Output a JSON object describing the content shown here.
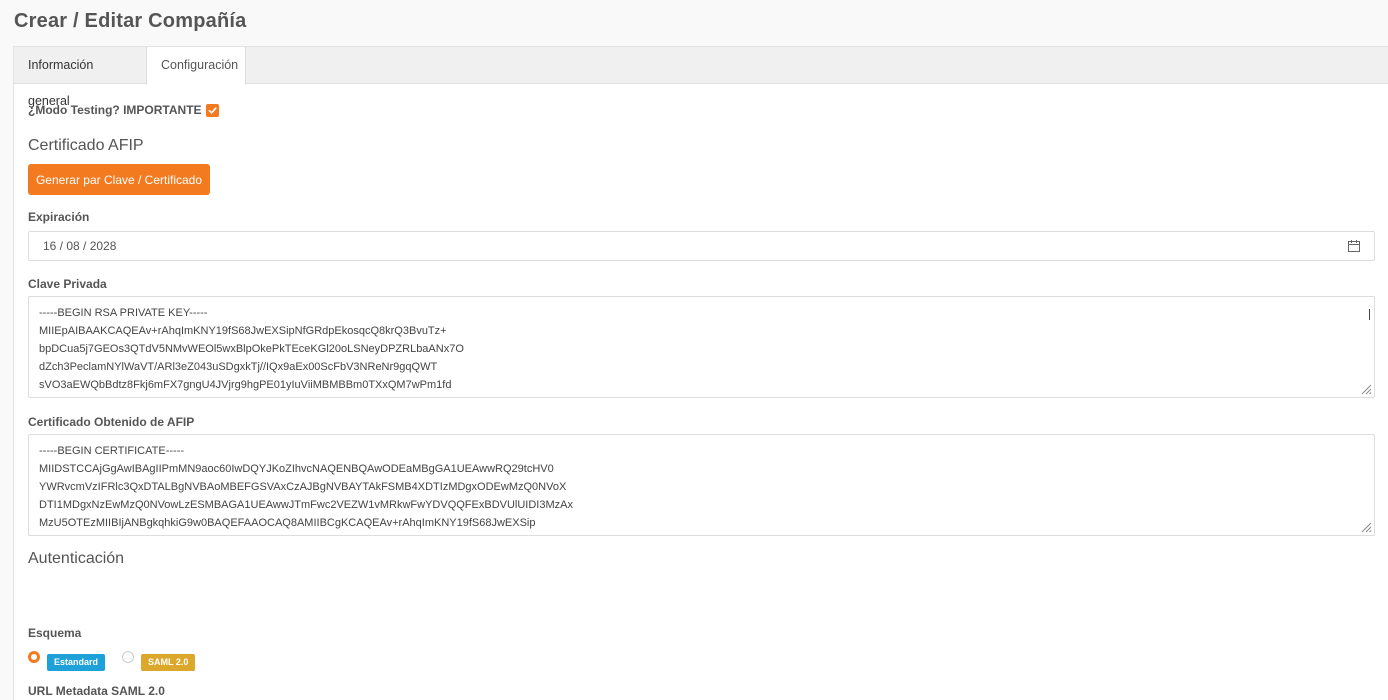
{
  "page": {
    "title": "Crear / Editar Compañía"
  },
  "tabs": [
    {
      "label": "Información general"
    },
    {
      "label": "Configuración"
    }
  ],
  "testing": {
    "label": "¿Modo Testing? IMPORTANTE",
    "checked": true
  },
  "afip": {
    "section_title": "Certificado AFIP",
    "generate_button": "Generar par Clave / Certificado",
    "expiration_label": "Expiración",
    "expiration_value": "16 / 08 / 2028",
    "private_key_label": "Clave Privada",
    "private_key_lines": [
      "-----BEGIN RSA PRIVATE KEY-----",
      "MIIEpAIBAAKCAQEAv+rAhqImKNY19fS68JwEXSipNfGRdpEkosqcQ8krQ3BvuTz+",
      "bpDCua5j7GEOs3QTdV5NMvWEOl5wxBlpOkePkTEceKGl20oLSNeyDPZRLbaANx7O",
      "dZch3PeclamNYlWaVT/ARl3eZ043uSDgxkTj//IQx9aEx00ScFbV3NReNr9gqQWT",
      "sVO3aEWQbBdtz8Fkj6mFX7gngU4JVjrg9hgPE01yIuViiMBMBBm0TXxQM7wPm1fd"
    ],
    "certificate_label": "Certificado Obtenido de AFIP",
    "certificate_lines": [
      "-----BEGIN CERTIFICATE-----",
      "MIIDSTCCAjGgAwIBAgIIPmMN9aoc60IwDQYJKoZIhvcNAQENBQAwODEaMBgGA1UEAwwRQ29tcHV0",
      "YWRvcmVzIFRlc3QxDTALBgNVBAoMBEFGSVAxCzAJBgNVBAYTAkFSMB4XDTIzMDgxODEwMzQ0NVoX",
      "DTI1MDgxNzEwMzQ0NVowLzESMBAGA1UEAwwJTmFwc2VEZW1vMRkwFwYDVQQFExBDVUlUIDI3MzAx",
      "MzU5OTEzMIIBIjANBgkqhkiG9w0BAQEFAAOCAQ8AMIIBCgKCAQEAv+rAhqImKNY19fS68JwEXSip"
    ]
  },
  "auth": {
    "section_title": "Autenticación",
    "schema_label": "Esquema",
    "options": [
      {
        "label": "Estandard",
        "selected": true
      },
      {
        "label": "SAML 2.0",
        "selected": false
      }
    ],
    "saml_url_label": "URL Metadata SAML 2.0",
    "saml_url_value": ""
  },
  "colors": {
    "accent": "#f47a20",
    "badge_standard": "#1ea0d8",
    "badge_saml": "#dca82b"
  },
  "icons": {
    "calendar": "calendar-icon",
    "checkbox": "check-icon",
    "resize": "resize-grip-icon"
  }
}
